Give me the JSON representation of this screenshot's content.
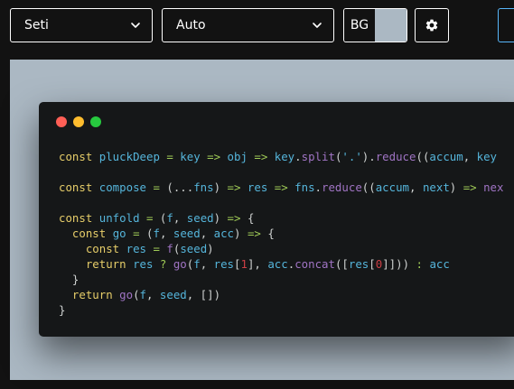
{
  "toolbar": {
    "theme_value": "Seti",
    "language_value": "Auto",
    "bg_label": "BG",
    "bg_color": "#abb8c3",
    "settings_icon": "gear-icon",
    "accent_color": "#57b5f9"
  },
  "canvas": {
    "background": "#abb8c3"
  },
  "window": {
    "background": "#151718",
    "controls": [
      "close",
      "minimize",
      "maximize"
    ]
  },
  "code": {
    "lines": [
      [
        {
          "t": "const ",
          "c": "kw"
        },
        {
          "t": "pluckDeep",
          "c": "fn"
        },
        {
          "t": " = ",
          "c": "op"
        },
        {
          "t": "key",
          "c": "va"
        },
        {
          "t": " => ",
          "c": "op"
        },
        {
          "t": "obj",
          "c": "va"
        },
        {
          "t": " => ",
          "c": "op"
        },
        {
          "t": "key",
          "c": "va"
        },
        {
          "t": ".",
          "c": "pu"
        },
        {
          "t": "split",
          "c": "me"
        },
        {
          "t": "(",
          "c": "pu"
        },
        {
          "t": "'.'",
          "c": "st"
        },
        {
          "t": ").",
          "c": "pu"
        },
        {
          "t": "reduce",
          "c": "me"
        },
        {
          "t": "((",
          "c": "pu"
        },
        {
          "t": "accum",
          "c": "va"
        },
        {
          "t": ", ",
          "c": "pu"
        },
        {
          "t": "key",
          "c": "va"
        }
      ],
      [],
      [
        {
          "t": "const ",
          "c": "kw"
        },
        {
          "t": "compose",
          "c": "fn"
        },
        {
          "t": " = ",
          "c": "op"
        },
        {
          "t": "(...",
          "c": "pu"
        },
        {
          "t": "fns",
          "c": "va"
        },
        {
          "t": ")",
          "c": "pu"
        },
        {
          "t": " => ",
          "c": "op"
        },
        {
          "t": "res",
          "c": "va"
        },
        {
          "t": " => ",
          "c": "op"
        },
        {
          "t": "fns",
          "c": "va"
        },
        {
          "t": ".",
          "c": "pu"
        },
        {
          "t": "reduce",
          "c": "me"
        },
        {
          "t": "((",
          "c": "pu"
        },
        {
          "t": "accum",
          "c": "va"
        },
        {
          "t": ", ",
          "c": "pu"
        },
        {
          "t": "next",
          "c": "va"
        },
        {
          "t": ")",
          "c": "pu"
        },
        {
          "t": " => ",
          "c": "op"
        },
        {
          "t": "nex",
          "c": "me"
        }
      ],
      [],
      [
        {
          "t": "const ",
          "c": "kw"
        },
        {
          "t": "unfold",
          "c": "fn"
        },
        {
          "t": " = ",
          "c": "op"
        },
        {
          "t": "(",
          "c": "pu"
        },
        {
          "t": "f",
          "c": "va"
        },
        {
          "t": ", ",
          "c": "pu"
        },
        {
          "t": "seed",
          "c": "va"
        },
        {
          "t": ")",
          "c": "pu"
        },
        {
          "t": " => ",
          "c": "op"
        },
        {
          "t": "{",
          "c": "pu"
        }
      ],
      [
        {
          "t": "  const ",
          "c": "kw"
        },
        {
          "t": "go",
          "c": "fn"
        },
        {
          "t": " = ",
          "c": "op"
        },
        {
          "t": "(",
          "c": "pu"
        },
        {
          "t": "f",
          "c": "va"
        },
        {
          "t": ", ",
          "c": "pu"
        },
        {
          "t": "seed",
          "c": "va"
        },
        {
          "t": ", ",
          "c": "pu"
        },
        {
          "t": "acc",
          "c": "va"
        },
        {
          "t": ")",
          "c": "pu"
        },
        {
          "t": " => ",
          "c": "op"
        },
        {
          "t": "{",
          "c": "pu"
        }
      ],
      [
        {
          "t": "    const ",
          "c": "kw"
        },
        {
          "t": "res",
          "c": "va"
        },
        {
          "t": " = ",
          "c": "op"
        },
        {
          "t": "f",
          "c": "me"
        },
        {
          "t": "(",
          "c": "pu"
        },
        {
          "t": "seed",
          "c": "va"
        },
        {
          "t": ")",
          "c": "pu"
        }
      ],
      [
        {
          "t": "    return ",
          "c": "kw"
        },
        {
          "t": "res",
          "c": "va"
        },
        {
          "t": " ? ",
          "c": "op"
        },
        {
          "t": "go",
          "c": "me"
        },
        {
          "t": "(",
          "c": "pu"
        },
        {
          "t": "f",
          "c": "va"
        },
        {
          "t": ", ",
          "c": "pu"
        },
        {
          "t": "res",
          "c": "va"
        },
        {
          "t": "[",
          "c": "pu"
        },
        {
          "t": "1",
          "c": "nu"
        },
        {
          "t": "], ",
          "c": "pu"
        },
        {
          "t": "acc",
          "c": "va"
        },
        {
          "t": ".",
          "c": "pu"
        },
        {
          "t": "concat",
          "c": "me"
        },
        {
          "t": "([",
          "c": "pu"
        },
        {
          "t": "res",
          "c": "va"
        },
        {
          "t": "[",
          "c": "pu"
        },
        {
          "t": "0",
          "c": "nu"
        },
        {
          "t": "]]))",
          "c": "pu"
        },
        {
          "t": " : ",
          "c": "op"
        },
        {
          "t": "acc",
          "c": "va"
        }
      ],
      [
        {
          "t": "  }",
          "c": "pu"
        }
      ],
      [
        {
          "t": "  return ",
          "c": "kw"
        },
        {
          "t": "go",
          "c": "me"
        },
        {
          "t": "(",
          "c": "pu"
        },
        {
          "t": "f",
          "c": "va"
        },
        {
          "t": ", ",
          "c": "pu"
        },
        {
          "t": "seed",
          "c": "va"
        },
        {
          "t": ", [])",
          "c": "pu"
        }
      ],
      [
        {
          "t": "}",
          "c": "pu"
        }
      ]
    ]
  }
}
